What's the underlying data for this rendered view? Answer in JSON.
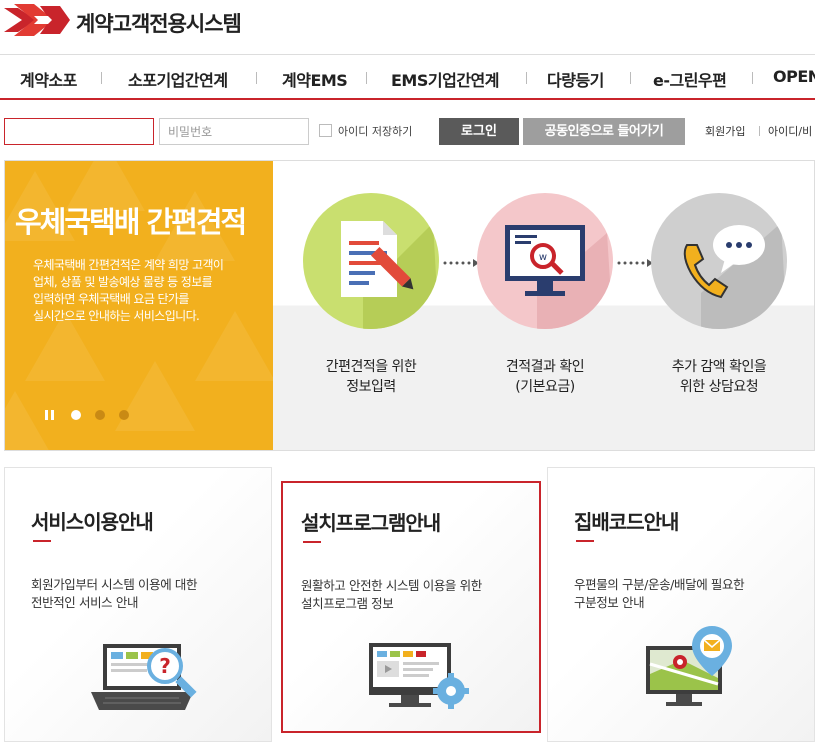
{
  "header": {
    "logo_text": "계약고객전용시스템"
  },
  "gnb": {
    "items": [
      "계약소포",
      "소포기업간연계",
      "계약EMS",
      "EMS기업간연계",
      "다량등기",
      "e-그린우편",
      "OPEN"
    ]
  },
  "login": {
    "id_value": "",
    "password_placeholder": "비밀번호",
    "save_id_label": "아이디 저장하기",
    "login_button": "로그인",
    "cert_button": "공동인증으로 들어가기",
    "join_link": "회원가입",
    "find_id_link": "아이디/비"
  },
  "hero": {
    "title": "우체국택배 간편견적",
    "desc_lines": [
      "우체국택배 간편견적은 계약 희망 고객이",
      "업체, 상품 및 발송예상 물량 등 정보를",
      "입력하면 우체국택배 요금 단가를",
      "실시간으로 안내하는 서비스입니다."
    ],
    "steps": [
      {
        "line1": "간편견적을 위한",
        "line2": "정보입력",
        "icon": "document-pen-icon",
        "color": "#c9df6f"
      },
      {
        "line1": "견적결과 확인",
        "line2": "(기본요금)",
        "icon": "monitor-search-icon",
        "color": "#f4c7ca"
      },
      {
        "line1": "추가 감액 확인을",
        "line2": "위한 상담요청",
        "icon": "phone-chat-icon",
        "color": "#cfcfcf"
      }
    ],
    "accent_color": "#f2b01e"
  },
  "cards": [
    {
      "title": "서비스이용안내",
      "desc_lines": [
        "회원가입부터 시스템 이용에 대한",
        "전반적인 서비스 안내"
      ],
      "icon": "laptop-help-icon"
    },
    {
      "title": "설치프로그램안내",
      "desc_lines": [
        "원활하고 안전한 시스템 이용을 위한",
        "설치프로그램 정보"
      ],
      "icon": "monitor-gear-icon"
    },
    {
      "title": "집배코드안내",
      "desc_lines": [
        "우편물의 구분/운송/배달에 필요한",
        "구분정보 안내"
      ],
      "icon": "map-pin-mail-icon"
    }
  ],
  "colors": {
    "brand_red": "#c9242b",
    "dark_button": "#5a5a5a",
    "gray_button": "#9e9e9e"
  }
}
